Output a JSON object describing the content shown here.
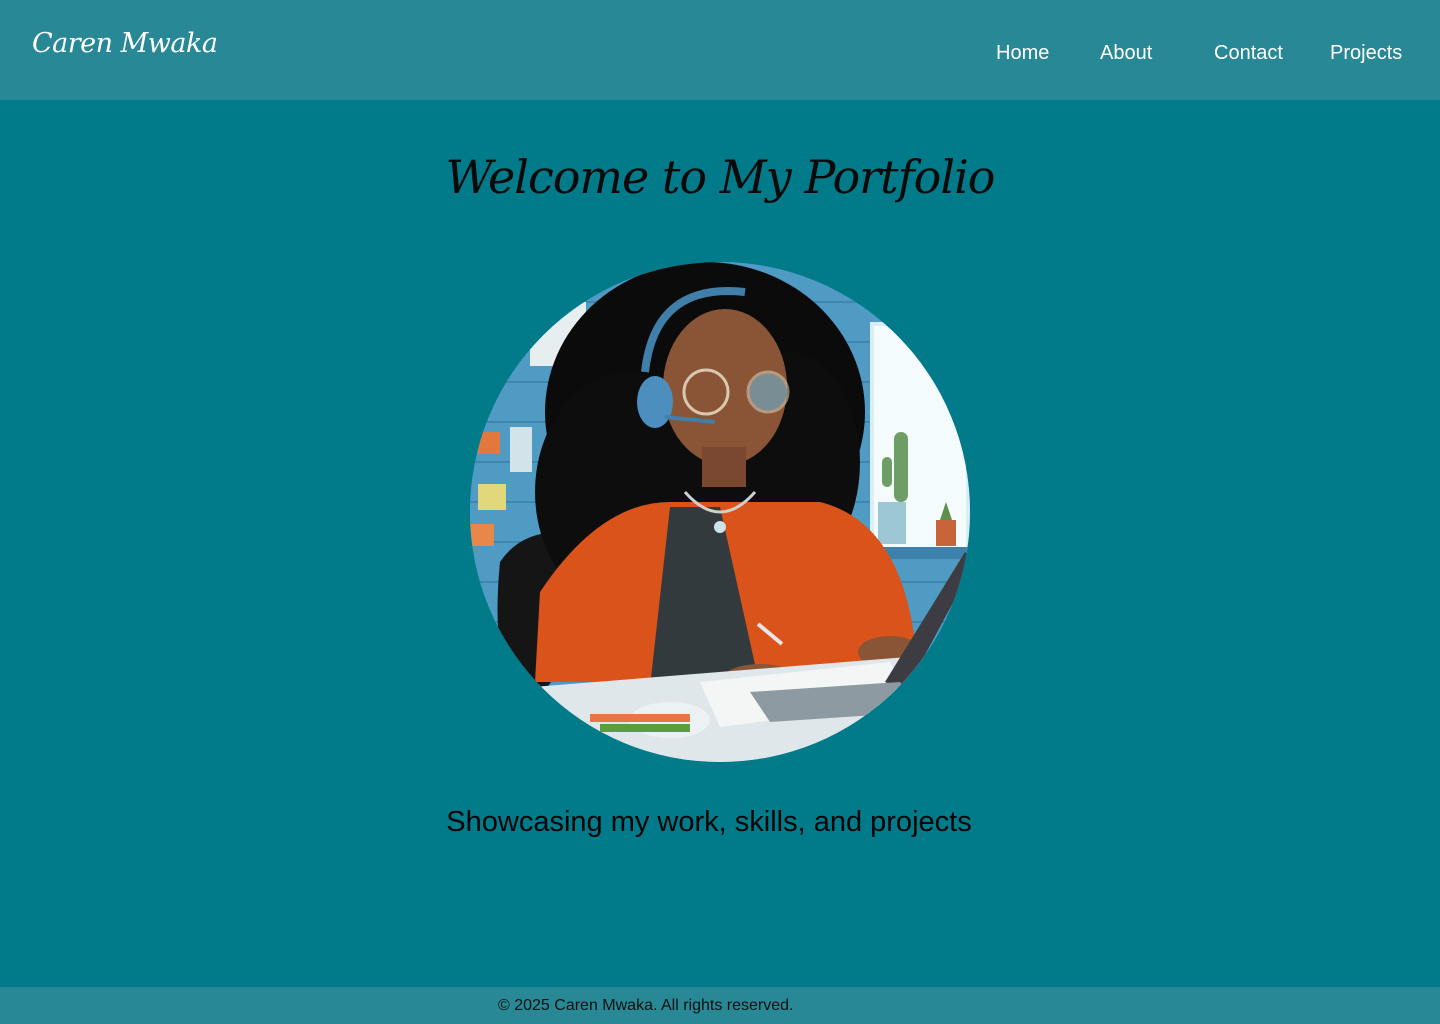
{
  "header": {
    "brand": "Caren Mwaka",
    "nav": {
      "home": "Home",
      "about": "About",
      "contact": "Contact",
      "projects": "Projects"
    }
  },
  "hero": {
    "title": "Welcome to My Portfolio",
    "tagline": "Showcasing my work, skills, and projects"
  },
  "footer": {
    "copyright": "© 2025 Caren Mwaka. All rights reserved."
  },
  "colors": {
    "page_background": "#017a8a",
    "header_background": "#298895",
    "footer_background": "#298895",
    "nav_text": "#ffffff"
  }
}
